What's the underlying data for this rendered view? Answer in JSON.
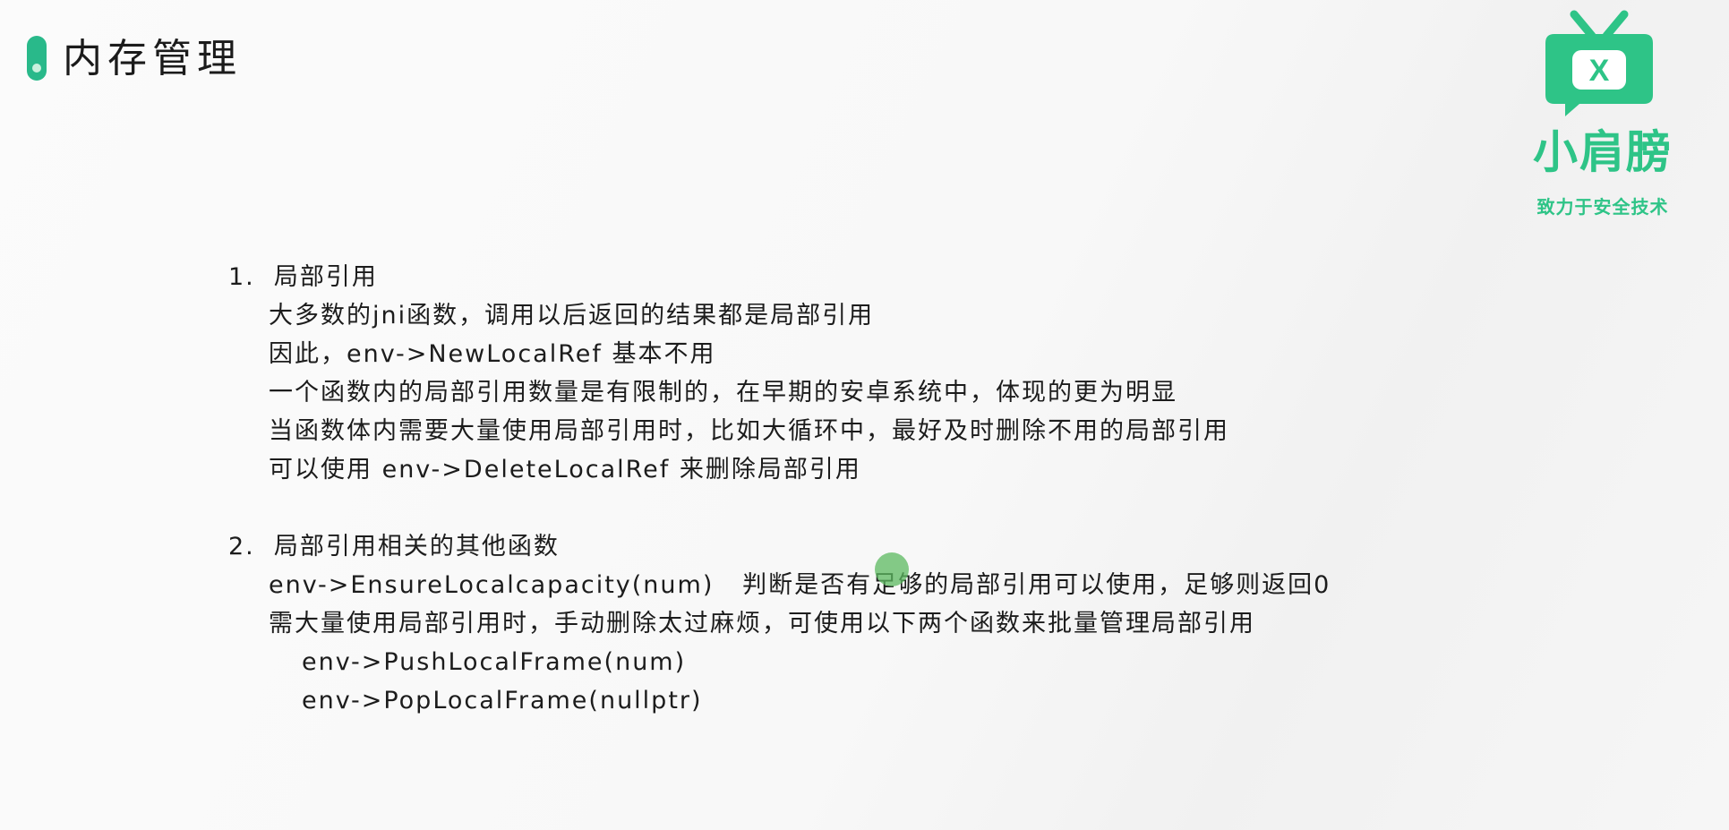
{
  "header": {
    "title": "内存管理"
  },
  "logo": {
    "brand": "小肩膀",
    "slogan": "致力于安全技术",
    "icon": "tv-x-icon",
    "color": "#2ec487"
  },
  "sections": [
    {
      "heading": "1.  局部引用",
      "lines": [
        "大多数的jni函数，调用以后返回的结果都是局部引用",
        "因此，env->NewLocalRef 基本不用",
        "一个函数内的局部引用数量是有限制的，在早期的安卓系统中，体现的更为明显",
        "当函数体内需要大量使用局部引用时，比如大循环中，最好及时删除不用的局部引用",
        "可以使用 env->DeleteLocalRef 来删除局部引用"
      ]
    },
    {
      "heading": "2.  局部引用相关的其他函数",
      "lines": [
        "env->EnsureLocalcapacity(num)   判断是否有足够的局部引用可以使用，足够则返回0",
        "需大量使用局部引用时，手动删除太过麻烦，可使用以下两个函数来批量管理局部引用"
      ],
      "sub_lines": [
        "env->PushLocalFrame(num)",
        "env->PopLocalFrame(nullptr)"
      ]
    }
  ],
  "accent_color": "#29b98a"
}
